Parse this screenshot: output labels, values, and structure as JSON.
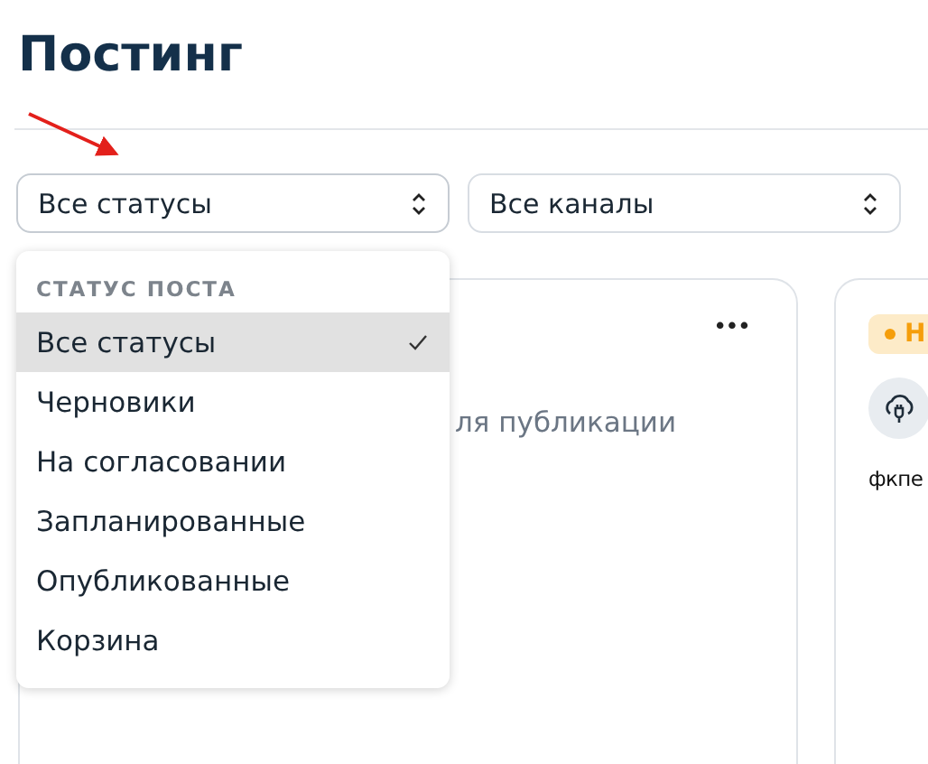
{
  "page": {
    "title": "Постинг"
  },
  "filters": [
    {
      "value": "Все статусы",
      "expanded": true
    },
    {
      "value": "Все каналы",
      "expanded": false
    }
  ],
  "status_menu": {
    "header": "СТАТУС ПОСТА",
    "items": [
      {
        "label": "Все статусы",
        "selected": true
      },
      {
        "label": "Черновики",
        "selected": false
      },
      {
        "label": "На согласовании",
        "selected": false
      },
      {
        "label": "Запланированные",
        "selected": false
      },
      {
        "label": "Опубликованные",
        "selected": false
      },
      {
        "label": "Корзина",
        "selected": false
      }
    ]
  },
  "cards": [
    {
      "menu": "•••",
      "text": "ля публикации"
    },
    {
      "badge": {
        "label": "Н",
        "color": "#f59e0b"
      },
      "author": "фкпе"
    }
  ]
}
